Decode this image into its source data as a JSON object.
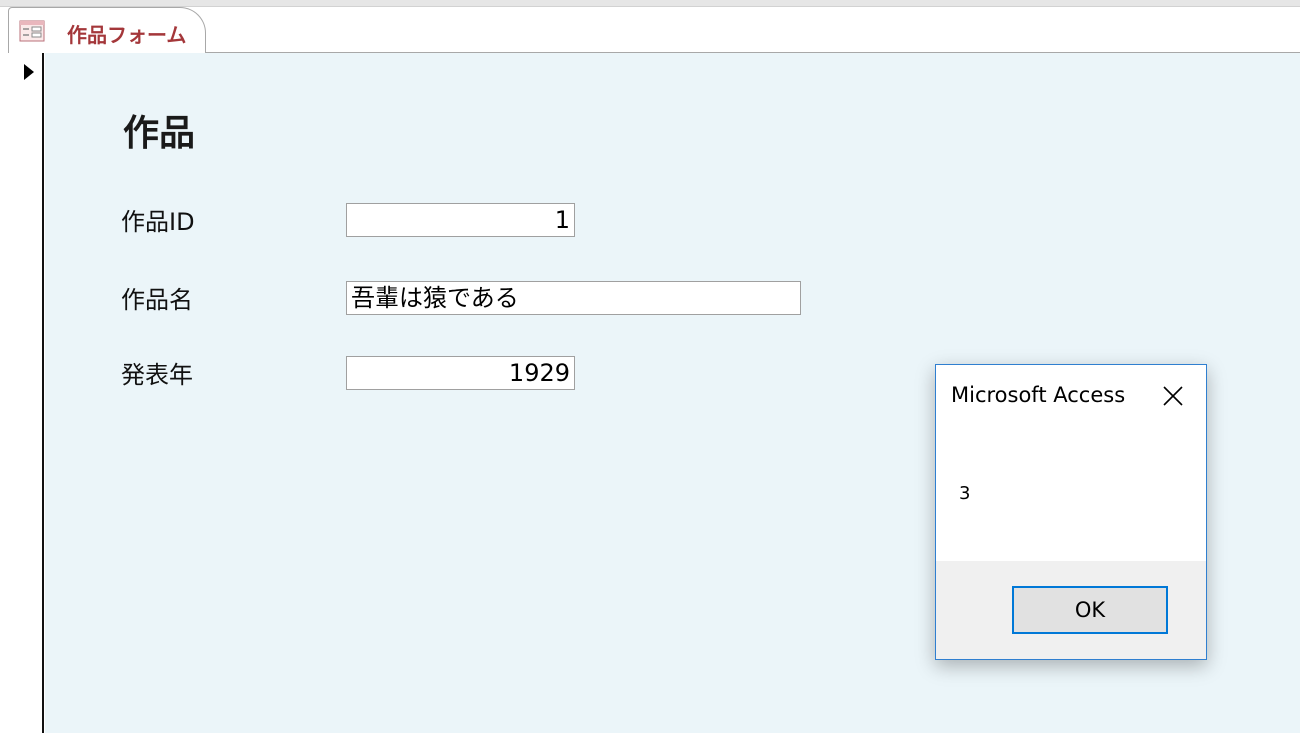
{
  "tab": {
    "label": "作品フォーム",
    "icon": "form-icon"
  },
  "form": {
    "title": "作品",
    "fields": [
      {
        "label": "作品ID",
        "value": "1"
      },
      {
        "label": "作品名",
        "value": "吾輩は猿である"
      },
      {
        "label": "発表年",
        "value": "1929"
      }
    ]
  },
  "dialog": {
    "title": "Microsoft Access",
    "message": "3",
    "ok_label": "OK",
    "close_icon": "close-icon"
  },
  "colors": {
    "form_background": "#ebf5f9",
    "tab_text": "#a4373a",
    "dialog_border": "#2f7fd0",
    "ok_border": "#0078d7"
  }
}
